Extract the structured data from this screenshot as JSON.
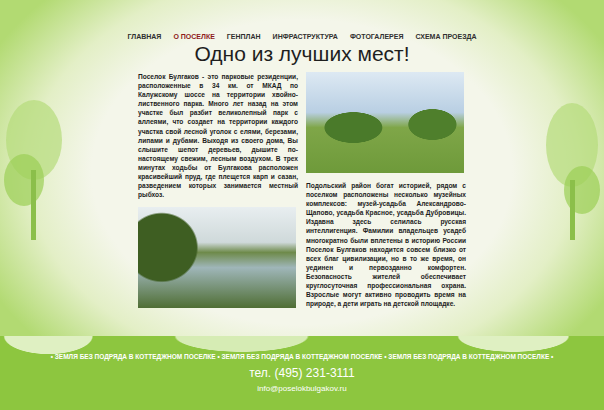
{
  "nav": [
    {
      "label": "ГЛАВНАЯ",
      "selected": false
    },
    {
      "label": "О ПОСЕЛКЕ",
      "selected": true
    },
    {
      "label": "ГЕНПЛАН",
      "selected": false
    },
    {
      "label": "ИНФРАСТРУКТУРА",
      "selected": false
    },
    {
      "label": "ФОТОГАЛЕРЕЯ",
      "selected": false
    },
    {
      "label": "СХЕМА ПРОЕЗДА",
      "selected": false
    }
  ],
  "title": "Одно из лучших мест!",
  "paragraphs": [
    "Поселок Булгаков - это парковые резиденции, расположенные в 34 км. от МКАД по Калужскому шоссе на территории хвойно-лиственного парка. Много лет назад на этом участке был разбит великолепный парк с аллеями, что создает на территории каждого участка свой лесной уголок с елями, березами, липами и дубами. Выходя из своего дома, Вы слышите шепот деревьев, дышите по-настоящему свежим, лесным воздухом. В трех минутах ходьбы от Булгакова расположен красивейший пруд, где плещется карп и сазан, разведением которых занимается местный рыбхоз.",
    "Подольский район богат историей, рядом с поселком расположены несколько музейных комплексов: музей-усадьба Александрово-Щапово, усадьба Красное, усадьба Дубровицы. Издавна здесь селилась русская интеллигенция. Фамилии владельцев усадеб многократно были вплетены в историю России Поселок Булгаков находится совсем близко от всех благ цивилизации, но в то же время, он уединен и первозданно комфортен. Безопасность жителей обеспечивает круглосуточная профессиональная охрана. Взрослые могут активно проводить время на природе, а дети играть на детской площадке."
  ],
  "ticker": "• ЗЕМЛЯ БЕЗ ПОДРЯДА В КОТТЕДЖНОМ ПОСЕЛКЕ • ЗЕМЛЯ БЕЗ ПОДРЯДА В КОТТЕДЖНОМ ПОСЕЛКЕ • ЗЕМЛЯ БЕЗ ПОДРЯДА В КОТТЕДЖНОМ ПОСЕЛКЕ •",
  "phone": "тел. (495) 231-3111",
  "email": "info@poselokbulgakov.ru"
}
